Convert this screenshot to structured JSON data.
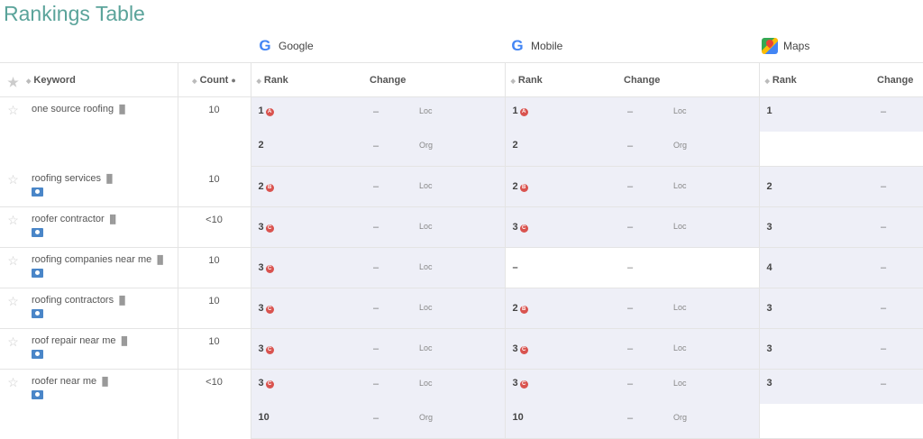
{
  "title": "Rankings Table",
  "engines": [
    {
      "name": "Google",
      "icon": "google-icon"
    },
    {
      "name": "Mobile",
      "icon": "google-icon"
    },
    {
      "name": "Maps",
      "icon": "google-maps-icon"
    }
  ],
  "columns": {
    "keyword": "Keyword",
    "count": "Count",
    "rank": "Rank",
    "change": "Change"
  },
  "rows": [
    {
      "keyword": "one source roofing",
      "count": "10",
      "local_pin": false,
      "lines": [
        {
          "g_rank": "1",
          "g_badge": "A",
          "g_change": "–",
          "g_type": "Loc",
          "m_rank": "1",
          "m_badge": "A",
          "m_change": "–",
          "m_type": "Loc",
          "maps_rank": "1",
          "maps_change": "–"
        },
        {
          "g_rank": "2",
          "g_badge": "",
          "g_change": "–",
          "g_type": "Org",
          "m_rank": "2",
          "m_badge": "",
          "m_change": "–",
          "m_type": "Org",
          "maps_rank": "",
          "maps_change": ""
        }
      ]
    },
    {
      "keyword": "roofing services",
      "count": "10",
      "local_pin": true,
      "lines": [
        {
          "g_rank": "2",
          "g_badge": "B",
          "g_change": "–",
          "g_type": "Loc",
          "m_rank": "2",
          "m_badge": "B",
          "m_change": "–",
          "m_type": "Loc",
          "maps_rank": "2",
          "maps_change": "–"
        }
      ]
    },
    {
      "keyword": "roofer contractor",
      "count": "<10",
      "local_pin": true,
      "lines": [
        {
          "g_rank": "3",
          "g_badge": "C",
          "g_change": "–",
          "g_type": "Loc",
          "m_rank": "3",
          "m_badge": "C",
          "m_change": "–",
          "m_type": "Loc",
          "maps_rank": "3",
          "maps_change": "–"
        }
      ]
    },
    {
      "keyword": "roofing companies near me",
      "count": "10",
      "local_pin": true,
      "lines": [
        {
          "g_rank": "3",
          "g_badge": "C",
          "g_change": "–",
          "g_type": "Loc",
          "m_rank": "–",
          "m_badge": "",
          "m_change": "–",
          "m_type": "",
          "maps_rank": "4",
          "maps_change": "–"
        }
      ]
    },
    {
      "keyword": "roofing contractors",
      "count": "10",
      "local_pin": true,
      "lines": [
        {
          "g_rank": "3",
          "g_badge": "C",
          "g_change": "–",
          "g_type": "Loc",
          "m_rank": "2",
          "m_badge": "B",
          "m_change": "–",
          "m_type": "Loc",
          "maps_rank": "3",
          "maps_change": "–"
        }
      ]
    },
    {
      "keyword": "roof repair near me",
      "count": "10",
      "local_pin": true,
      "lines": [
        {
          "g_rank": "3",
          "g_badge": "C",
          "g_change": "–",
          "g_type": "Loc",
          "m_rank": "3",
          "m_badge": "C",
          "m_change": "–",
          "m_type": "Loc",
          "maps_rank": "3",
          "maps_change": "–"
        }
      ]
    },
    {
      "keyword": "roofer near me",
      "count": "<10",
      "local_pin": true,
      "lines": [
        {
          "g_rank": "3",
          "g_badge": "C",
          "g_change": "–",
          "g_type": "Loc",
          "m_rank": "3",
          "m_badge": "C",
          "m_change": "–",
          "m_type": "Loc",
          "maps_rank": "3",
          "maps_change": "–"
        },
        {
          "g_rank": "10",
          "g_badge": "",
          "g_change": "–",
          "g_type": "Org",
          "m_rank": "10",
          "m_badge": "",
          "m_change": "–",
          "m_type": "Org",
          "maps_rank": "",
          "maps_change": ""
        }
      ]
    }
  ],
  "colors": {
    "title": "#5aa39a",
    "row_tint": "#eeeff7",
    "badge": "#d9534f"
  }
}
